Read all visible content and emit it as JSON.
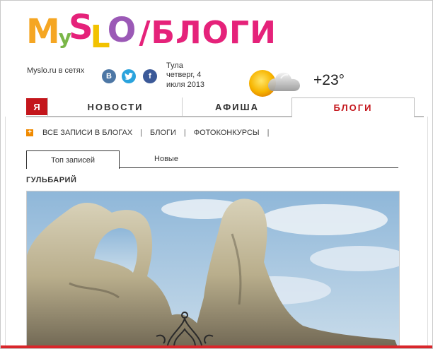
{
  "logo": {
    "letters": [
      "M",
      "y",
      "S",
      "L",
      "O"
    ],
    "section": "/БЛОГИ"
  },
  "social": {
    "label": "Myslo.ru в сетях",
    "vk": "В",
    "twitter": "t",
    "facebook": "f"
  },
  "location": {
    "city": "Тула",
    "date": "четверг, 4 июля 2013"
  },
  "weather": {
    "icon": "partly-cloudy-icon",
    "temp": "+23°"
  },
  "nav": {
    "home": "Я",
    "items": [
      "НОВОСТИ",
      "АФИША",
      "БЛОГИ"
    ],
    "active": "БЛОГИ",
    "active_color": "#c4161c"
  },
  "subnav": {
    "items": [
      "ВСЕ ЗАПИСИ В БЛОГАХ",
      "БЛОГИ",
      "ФОТОКОНКУРСЫ"
    ]
  },
  "tabs": {
    "items": [
      "Топ записей",
      "Новые"
    ],
    "active": "Топ записей"
  },
  "post": {
    "title": "ГУЛЬБАРИЙ",
    "image": "rock-formation-photo"
  }
}
